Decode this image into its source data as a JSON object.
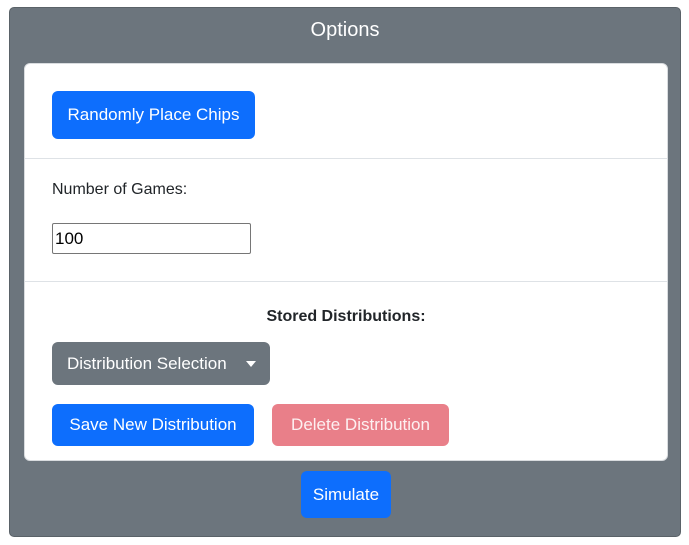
{
  "panel": {
    "title": "Options"
  },
  "controls": {
    "random_place_label": "Randomly Place Chips",
    "number_of_games_label": "Number of Games:",
    "number_of_games_value": "100",
    "stored_distributions_label": "Stored Distributions:",
    "distribution_select_label": "Distribution Selection",
    "save_label": "Save New Distribution",
    "delete_label": "Delete Distribution",
    "simulate_label": "Simulate"
  },
  "colors": {
    "panel_bg": "#6c757d",
    "primary": "#0d6efd",
    "secondary": "#6c757d",
    "danger_disabled": "#e97f89"
  }
}
